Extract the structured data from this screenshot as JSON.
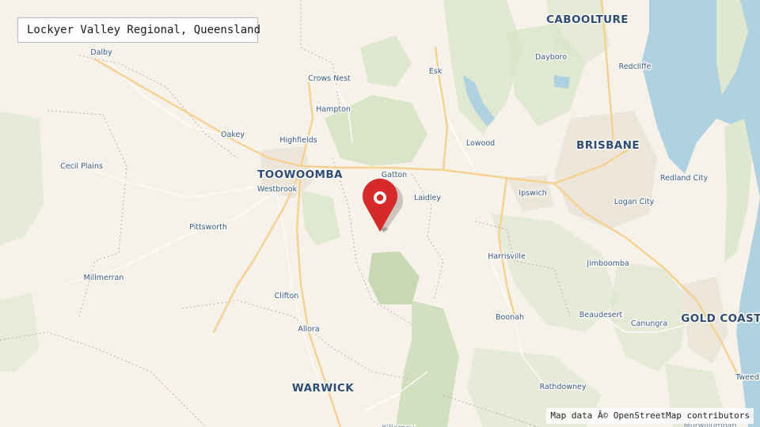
{
  "title": "Lockyer Valley Regional, Queensland",
  "attribution": "Map data Â© OpenStreetMap contributors",
  "colors": {
    "land": "#f6f2ea",
    "water": "#aed2df",
    "park": "#d6e2c4",
    "forest_dark": "#c3d5b0",
    "major_road": "#f4d28e",
    "urban": "#ece7dd",
    "marker": "#d62a2a",
    "label": "#3a5c86"
  },
  "marker": {
    "icon": "map-pin-icon",
    "label": "Lockyer Valley Regional"
  },
  "places": [
    {
      "name": "CABOOLTURE",
      "size": "major"
    },
    {
      "name": "Dalby",
      "size": "minor"
    },
    {
      "name": "Dayboro",
      "size": "minor"
    },
    {
      "name": "Redcliffe",
      "size": "minor"
    },
    {
      "name": "Crows Nest",
      "size": "minor"
    },
    {
      "name": "Esk",
      "size": "minor"
    },
    {
      "name": "Hampton",
      "size": "minor"
    },
    {
      "name": "Oakey",
      "size": "minor"
    },
    {
      "name": "Highfields",
      "size": "minor"
    },
    {
      "name": "Lowood",
      "size": "minor"
    },
    {
      "name": "BRISBANE",
      "size": "major"
    },
    {
      "name": "Cecil Plains",
      "size": "minor"
    },
    {
      "name": "TOOWOOMBA",
      "size": "major"
    },
    {
      "name": "Gatton",
      "size": "minor"
    },
    {
      "name": "Redland City",
      "size": "minor"
    },
    {
      "name": "Westbrook",
      "size": "minor"
    },
    {
      "name": "Ipswich",
      "size": "minor"
    },
    {
      "name": "Laidley",
      "size": "minor"
    },
    {
      "name": "Logan City",
      "size": "minor"
    },
    {
      "name": "Pittsworth",
      "size": "minor"
    },
    {
      "name": "Harrisville",
      "size": "minor"
    },
    {
      "name": "Jimboomba",
      "size": "minor"
    },
    {
      "name": "Millmerran",
      "size": "minor"
    },
    {
      "name": "Clifton",
      "size": "minor"
    },
    {
      "name": "Boonah",
      "size": "minor"
    },
    {
      "name": "Beaudesert",
      "size": "minor"
    },
    {
      "name": "GOLD COAST",
      "size": "major"
    },
    {
      "name": "Canungra",
      "size": "minor"
    },
    {
      "name": "Allora",
      "size": "minor"
    },
    {
      "name": "Tweed",
      "size": "minor"
    },
    {
      "name": "WARWICK",
      "size": "major"
    },
    {
      "name": "Rathdowney",
      "size": "minor"
    },
    {
      "name": "Killarney",
      "size": "minor"
    },
    {
      "name": "Murwillumbah",
      "size": "minor"
    }
  ]
}
